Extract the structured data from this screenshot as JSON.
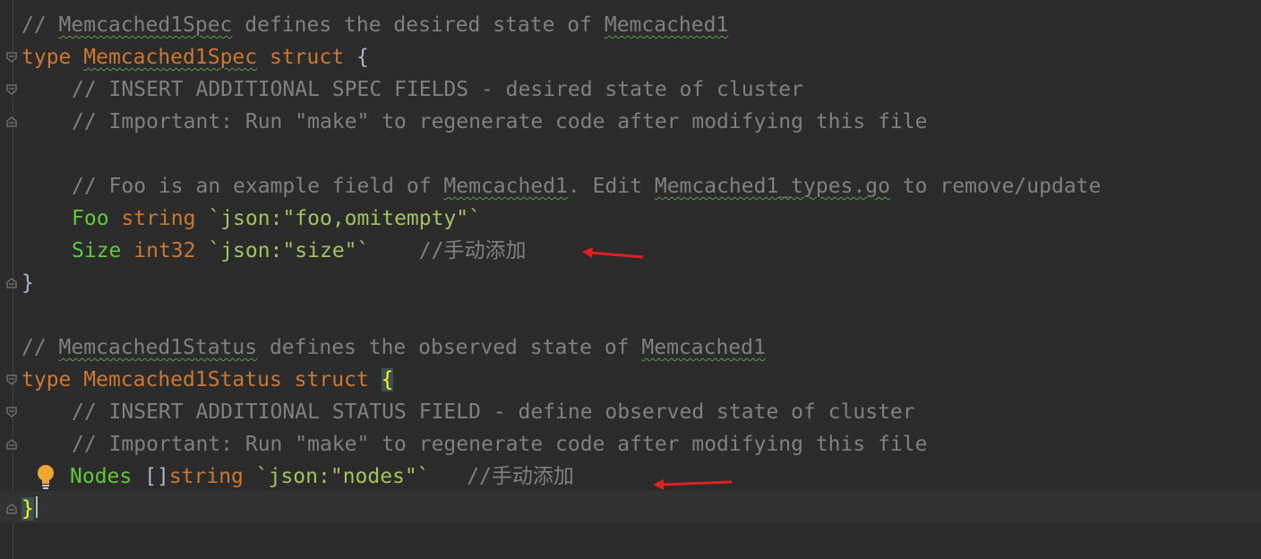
{
  "code": {
    "l1": {
      "pre": "// ",
      "a": "Memcached1Spec",
      "mid": " defines the desired state of ",
      "b": "Memcached1"
    },
    "l2": {
      "kw1": "type",
      "name": "Memcached1Spec",
      "kw2": "struct",
      "brace": "{"
    },
    "l3": {
      "text": "// INSERT ADDITIONAL SPEC FIELDS - desired state of cluster"
    },
    "l4": {
      "text": "// Important: Run \"make\" to regenerate code after modifying this file"
    },
    "l6": {
      "pre": "// Foo is an example field of ",
      "a": "Memcached1",
      "mid": ". Edit ",
      "b": "Memcached1_types.go",
      "post": " to remove/update"
    },
    "l7": {
      "field": "Foo",
      "type": "string",
      "tag": "`json:\"foo,omitempty\"`"
    },
    "l8": {
      "field": "Size",
      "type": "int32",
      "tag": "`json:\"size\"`",
      "comment": "//手动添加"
    },
    "l9": {
      "brace": "}"
    },
    "l11": {
      "pre": "// ",
      "a": "Memcached1Status",
      "mid": " defines the observed state of ",
      "b": "Memcached1"
    },
    "l12": {
      "kw1": "type",
      "name": "Memcached1Status",
      "kw2": "struct",
      "brace": "{"
    },
    "l13": {
      "text": "// INSERT ADDITIONAL STATUS FIELD - define observed state of cluster"
    },
    "l14": {
      "text": "// Important: Run \"make\" to regenerate code after modifying this file"
    },
    "l15": {
      "field": "Nodes",
      "slice": "[]",
      "type": "string",
      "tag": "`json:\"nodes\"`",
      "comment": "//手动添加"
    },
    "l16": {
      "brace": "}"
    }
  },
  "colors": {
    "background": "#2b2b2b",
    "comment": "#808080",
    "keyword": "#cc7832",
    "field": "#60c93a",
    "annotation_arrow": "#e02020"
  },
  "icons": [
    "fold-marker-icon",
    "lightbulb-icon",
    "red-arrow-annotation"
  ]
}
